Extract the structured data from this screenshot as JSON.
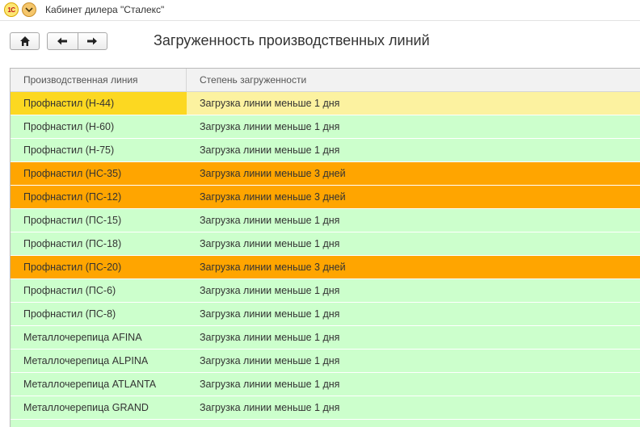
{
  "window": {
    "title": "Кабинет дилера \"Сталекс\"",
    "logo_text": "1С"
  },
  "page": {
    "title": "Загруженность производственных линий"
  },
  "icons": {
    "logo": "1c-logo-icon",
    "menu": "chevron-down-icon",
    "home": "home-icon",
    "back": "arrow-left-icon",
    "forward": "arrow-right-icon"
  },
  "colors": {
    "green": "#ccffcc",
    "orange": "#ffa500",
    "selected_cell": "#fcd821",
    "selected_row": "#fcf2a0"
  },
  "table": {
    "columns": [
      "Производственная линия",
      "Степень загруженности"
    ],
    "rows": [
      {
        "line": "Профнастил (Н-44)",
        "load": "Загрузка линии меньше 1 дня",
        "status": "selected"
      },
      {
        "line": "Профнастил (Н-60)",
        "load": "Загрузка линии меньше 1 дня",
        "status": "green"
      },
      {
        "line": "Профнастил (Н-75)",
        "load": "Загрузка линии меньше 1 дня",
        "status": "green"
      },
      {
        "line": "Профнастил (НС-35)",
        "load": "Загрузка линии меньше 3 дней",
        "status": "orange"
      },
      {
        "line": "Профнастил (ПС-12)",
        "load": "Загрузка линии меньше 3 дней",
        "status": "orange"
      },
      {
        "line": "Профнастил (ПС-15)",
        "load": "Загрузка линии меньше 1 дня",
        "status": "green"
      },
      {
        "line": "Профнастил (ПС-18)",
        "load": "Загрузка линии меньше 1 дня",
        "status": "green"
      },
      {
        "line": "Профнастил (ПС-20)",
        "load": "Загрузка линии меньше 3 дней",
        "status": "orange"
      },
      {
        "line": "Профнастил (ПС-6)",
        "load": "Загрузка линии меньше 1 дня",
        "status": "green"
      },
      {
        "line": "Профнастил (ПС-8)",
        "load": "Загрузка линии меньше 1 дня",
        "status": "green"
      },
      {
        "line": "Металлочерепица AFINA",
        "load": "Загрузка линии меньше 1 дня",
        "status": "green"
      },
      {
        "line": "Металлочерепица ALPINA",
        "load": "Загрузка линии меньше 1 дня",
        "status": "green"
      },
      {
        "line": "Металлочерепица ATLANTA",
        "load": "Загрузка линии меньше 1 дня",
        "status": "green"
      },
      {
        "line": "Металлочерепица GRAND",
        "load": "Загрузка линии меньше 1 дня",
        "status": "green"
      },
      {
        "line": "",
        "load": "",
        "status": "green"
      }
    ]
  }
}
